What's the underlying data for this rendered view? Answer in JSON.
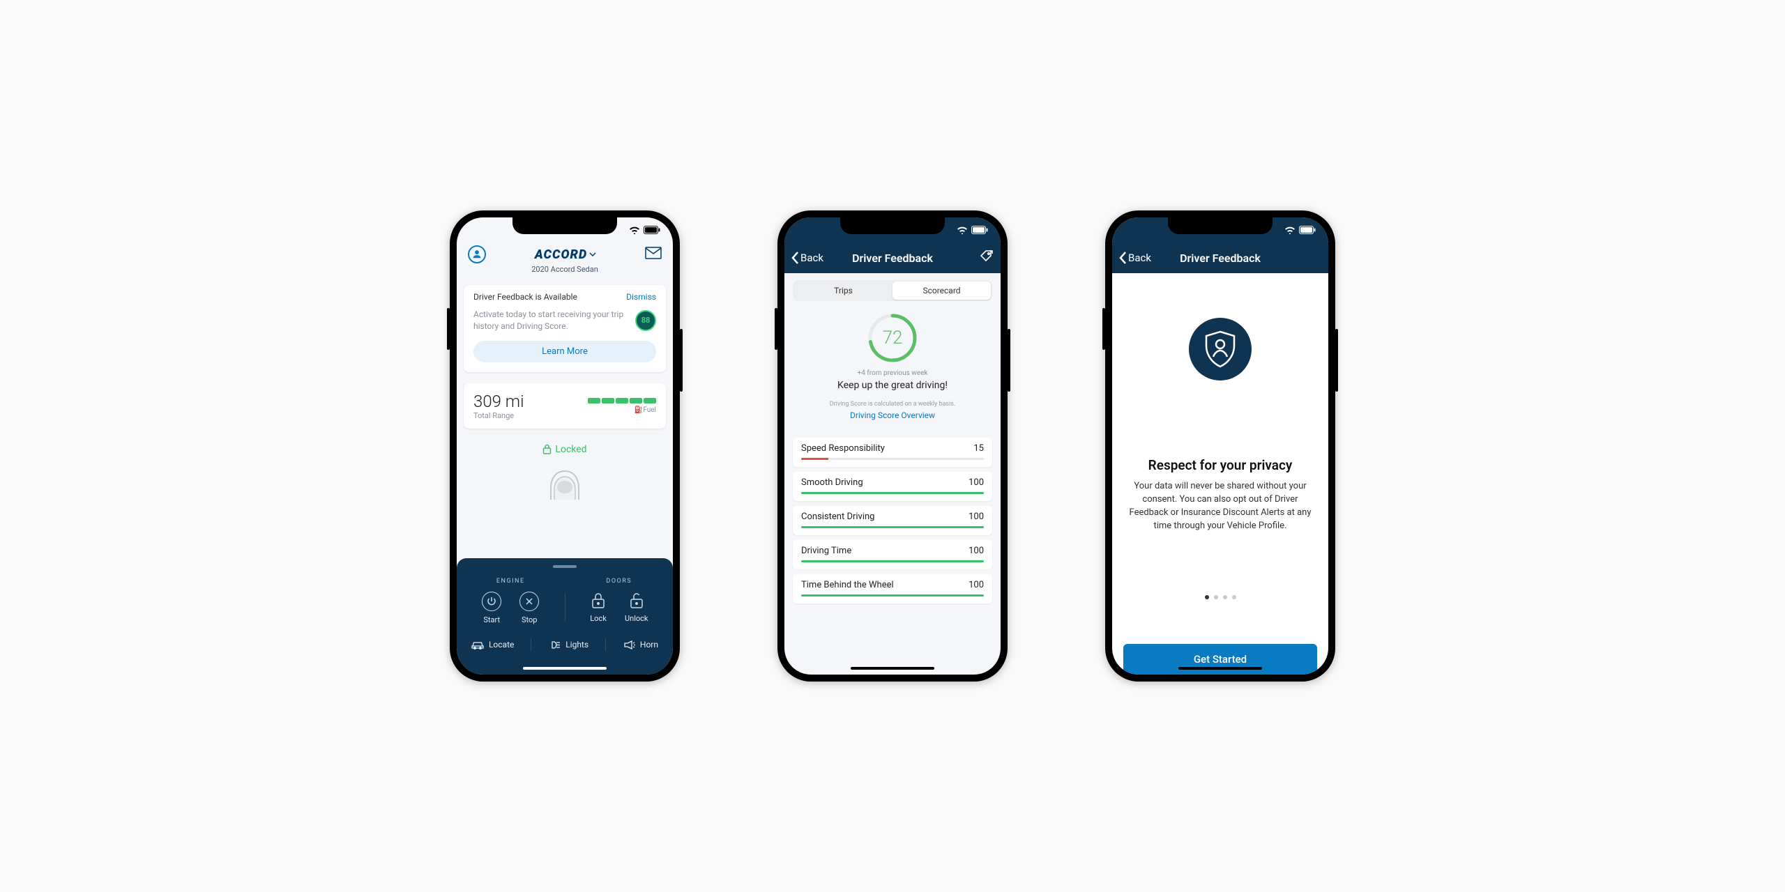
{
  "screen1": {
    "logo_text": "ACCORD",
    "subtitle": "2020 Accord Sedan",
    "card": {
      "title": "Driver Feedback is Available",
      "dismiss": "Dismiss",
      "message": "Activate today to start receiving your trip history and Driving Score.",
      "badge_value": "88",
      "learn_more": "Learn More"
    },
    "range": {
      "value": "309 mi",
      "label": "Total Range",
      "fuel_label": "⛽Fuel"
    },
    "locked_label": "Locked",
    "drawer": {
      "engine_title": "ENGINE",
      "doors_title": "DOORS",
      "start": "Start",
      "stop": "Stop",
      "lock": "Lock",
      "unlock": "Unlock",
      "locate": "Locate",
      "lights": "Lights",
      "horn": "Horn"
    }
  },
  "screen2": {
    "back": "Back",
    "title": "Driver Feedback",
    "tabs": {
      "trips": "Trips",
      "scorecard": "Scorecard"
    },
    "score": "72",
    "delta": "+4 from previous week",
    "keep": "Keep up the great driving!",
    "note": "Driving Score is calculated on a weekly basis.",
    "link": "Driving Score Overview",
    "metrics": [
      {
        "name": "Speed Responsibility",
        "value": "15",
        "pct": 15,
        "color": "red"
      },
      {
        "name": "Smooth Driving",
        "value": "100",
        "pct": 100,
        "color": "green"
      },
      {
        "name": "Consistent Driving",
        "value": "100",
        "pct": 100,
        "color": "green"
      },
      {
        "name": "Driving Time",
        "value": "100",
        "pct": 100,
        "color": "green"
      },
      {
        "name": "Time Behind the Wheel",
        "value": "100",
        "pct": 100,
        "color": "green"
      }
    ]
  },
  "screen3": {
    "back": "Back",
    "title": "Driver Feedback",
    "heading": "Respect for your privacy",
    "desc": "Your data will never be shared without your consent. You can also opt out of Driver Feedback or Insurance Discount Alerts at any time through your Vehicle Profile.",
    "cta": "Get Started"
  }
}
